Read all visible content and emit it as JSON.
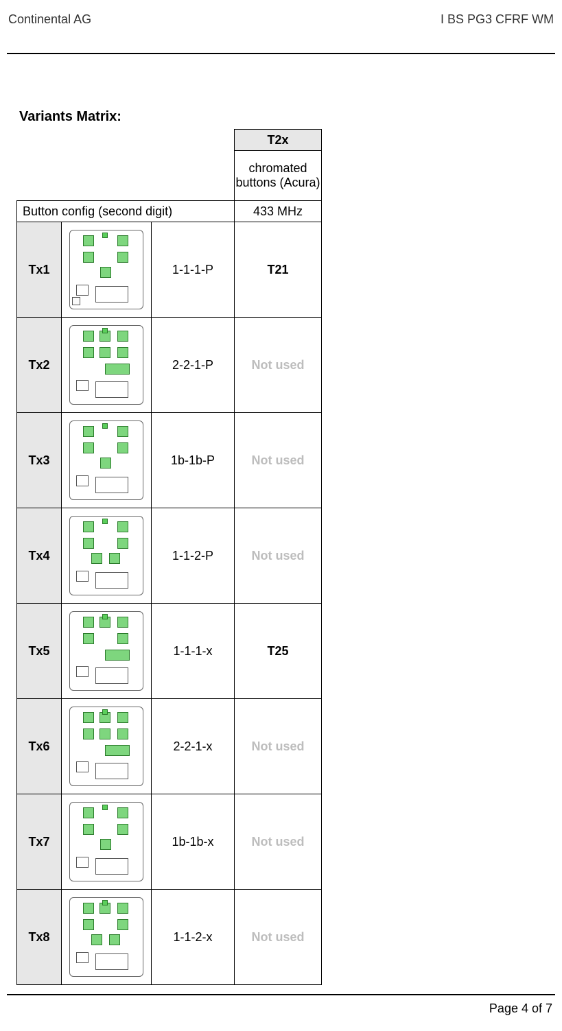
{
  "header": {
    "left": "Continental AG",
    "right": "I BS PG3 CFRF WM"
  },
  "section_title": "Variants Matrix:",
  "table": {
    "corner_blank": "",
    "col_header_top": "T2x",
    "col_header_sub1": "chromated buttons (Acura)",
    "row_header_label": "Button config (second digit)",
    "col_header_sub2": "433 MHz",
    "rows": [
      {
        "id": "Tx1",
        "code": "1-1-1-P",
        "value": "T21",
        "used": true
      },
      {
        "id": "Tx2",
        "code": "2-2-1-P",
        "value": "Not used",
        "used": false
      },
      {
        "id": "Tx3",
        "code": "1b-1b-P",
        "value": "Not used",
        "used": false
      },
      {
        "id": "Tx4",
        "code": "1-1-2-P",
        "value": "Not used",
        "used": false
      },
      {
        "id": "Tx5",
        "code": "1-1-1-x",
        "value": "T25",
        "used": true
      },
      {
        "id": "Tx6",
        "code": "2-2-1-x",
        "value": "Not used",
        "used": false
      },
      {
        "id": "Tx7",
        "code": "1b-1b-x",
        "value": "Not used",
        "used": false
      },
      {
        "id": "Tx8",
        "code": "1-1-2-x",
        "value": "Not used",
        "used": false
      }
    ]
  },
  "footer": {
    "page": "Page 4 of 7"
  }
}
